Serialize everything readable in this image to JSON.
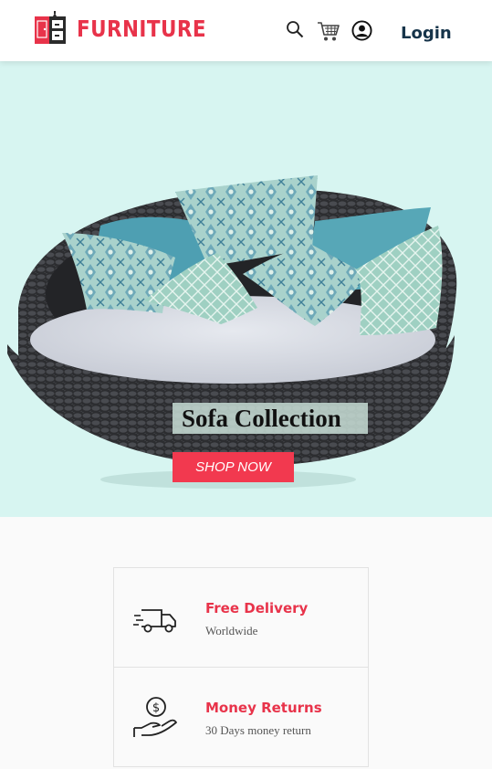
{
  "header": {
    "brand": "FURNITURE",
    "login_label": "Login",
    "icons": [
      "search-icon",
      "cart-icon",
      "user-icon"
    ]
  },
  "hero": {
    "title": "Sofa Collection",
    "cta_label": "SHOP NOW"
  },
  "features": [
    {
      "icon": "truck-icon",
      "title": "Free Delivery",
      "subtitle": "Worldwide"
    },
    {
      "icon": "money-hand-icon",
      "title": "Money Returns",
      "subtitle": "30 Days money return"
    }
  ],
  "colors": {
    "brand": "#e8334a",
    "hero_bg": "#d7f5f1",
    "cta": "#f2394f",
    "login": "#16344a"
  }
}
